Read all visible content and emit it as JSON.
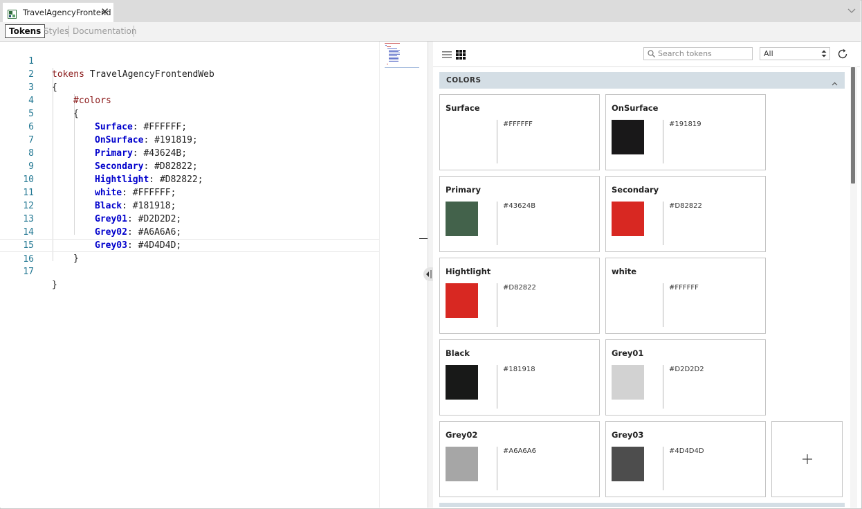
{
  "document_tab": {
    "title": "TravelAgencyFrontend"
  },
  "subtabs": [
    {
      "label": "Tokens"
    },
    {
      "label": "Styles"
    },
    {
      "label": "Documentation"
    }
  ],
  "editor": {
    "line_numbers": [
      "1",
      "2",
      "3",
      "4",
      "5",
      "6",
      "7",
      "8",
      "9",
      "10",
      "11",
      "12",
      "13",
      "14",
      "15",
      "16",
      "17"
    ],
    "header_keyword": "tokens",
    "header_name": "TravelAgencyFrontendWeb",
    "open_brace": "{",
    "close_brace": "}",
    "group_keyword": "#colors",
    "tokens": [
      {
        "name": "Surface",
        "value": "#FFFFFF"
      },
      {
        "name": "OnSurface",
        "value": "#191819"
      },
      {
        "name": "Primary",
        "value": "#43624B"
      },
      {
        "name": "Secondary",
        "value": "#D82822"
      },
      {
        "name": "Hightlight",
        "value": "#D82822"
      },
      {
        "name": "white",
        "value": "#FFFFFF"
      },
      {
        "name": "Black",
        "value": "#181918"
      },
      {
        "name": "Grey01",
        "value": "#D2D2D2"
      },
      {
        "name": "Grey02",
        "value": "#A6A6A6"
      },
      {
        "name": "Grey03",
        "value": "#4D4D4D"
      }
    ]
  },
  "preview": {
    "search_placeholder": "Search tokens",
    "filter_value": "All",
    "section_title": "COLORS",
    "cards": [
      {
        "name": "Surface",
        "hex": "#FFFFFF",
        "color": "#FFFFFF"
      },
      {
        "name": "OnSurface",
        "hex": "#191819",
        "color": "#191819"
      },
      {
        "name": "Primary",
        "hex": "#43624B",
        "color": "#43624B"
      },
      {
        "name": "Secondary",
        "hex": "#D82822",
        "color": "#D82822"
      },
      {
        "name": "Hightlight",
        "hex": "#D82822",
        "color": "#D82822"
      },
      {
        "name": "white",
        "hex": "#FFFFFF",
        "color": "#FFFFFF"
      },
      {
        "name": "Black",
        "hex": "#181918",
        "color": "#181918"
      },
      {
        "name": "Grey01",
        "hex": "#D2D2D2",
        "color": "#D2D2D2"
      },
      {
        "name": "Grey02",
        "hex": "#A6A6A6",
        "color": "#A6A6A6"
      },
      {
        "name": "Grey03",
        "hex": "#4D4D4D",
        "color": "#4D4D4D"
      }
    ]
  },
  "colors": {
    "section_bg": "#D4DEE5",
    "line_number": "#237893",
    "keyword": "#8B1A1A",
    "property": "#0000CC"
  }
}
